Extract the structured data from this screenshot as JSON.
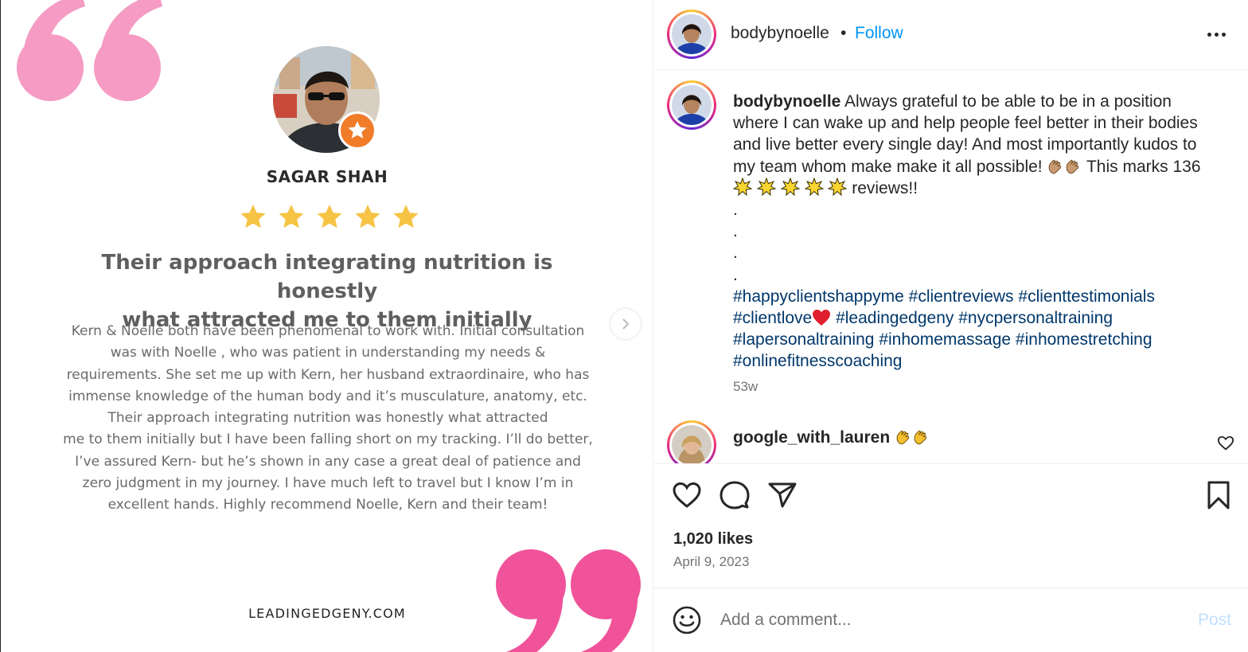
{
  "review_card": {
    "reviewer_name": "SAGAR SHAH",
    "rating_stars": 5,
    "headline_lines": [
      "Their approach integrating nutrition is honestly",
      "what attracted me to them initially"
    ],
    "body_lines": [
      "Kern & Noelle both have been phenomenal to work with. Initial consultation",
      "was with Noelle , who was patient in understanding my needs &",
      "requirements. She set me up with Kern, her husband extraordinaire, who has",
      "immense knowledge of the human body and it’s musculature, anatomy, etc.",
      "Their approach integrating nutrition was honestly what attracted",
      "me to them initially but I have been falling short on my tracking. I’ll do better,",
      "I’ve assured Kern- but he’s shown in any case a great deal of patience and",
      "zero judgment in my journey. I have much left to travel but I know I’m in",
      "excellent hands. Highly recommend Noelle, Kern and their team!"
    ],
    "website": "LEADINGEDGENY.COM",
    "colors": {
      "quote_open": "#f59bc4",
      "quote_close": "#f0539a",
      "star": "#f6c344",
      "badge": "#f07c2a"
    }
  },
  "post": {
    "author": "bodybynoelle",
    "separator": "•",
    "follow_label": "Follow",
    "more_icon": "more-horizontal-icon",
    "caption": {
      "username": "bodybynoelle",
      "line1": "Always grateful to be able to be in a position",
      "line2": "where I can wake up and help people feel better in their bodies",
      "line3": "and live better every single day! And most importantly kudos to",
      "line4": "my team whom make make it all possible!",
      "line4_tail": "This marks 136",
      "line5_tail": "reviews!!",
      "dots": [
        ".",
        ".",
        ".",
        "."
      ],
      "hashtags": {
        "h1": "#happyclientshappyme",
        "h2": "#clientreviews",
        "h3": "#clienttestimonials",
        "h4": "#clientlove",
        "h5": "#leadingedgeny",
        "h6": "#nycpersonaltraining",
        "h7": "#lapersonaltraining",
        "h8": "#inhomemassage",
        "h9": "#inhomestretching",
        "h10": "#onlinefitnesscoaching"
      }
    },
    "time_ago": "53w",
    "comment": {
      "username": "google_with_lauren"
    },
    "likes": "1,020 likes",
    "date": "April 9, 2023",
    "comment_placeholder": "Add a comment...",
    "post_label": "Post",
    "colors": {
      "link": "#0095f6",
      "hashtag": "#00376b",
      "muted": "#737373"
    }
  }
}
